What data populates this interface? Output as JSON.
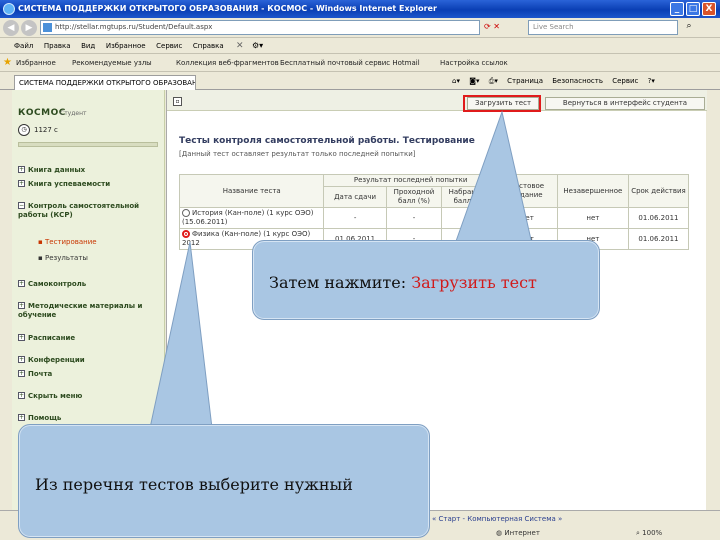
{
  "window": {
    "title": "СИСТЕМА ПОДДЕРЖКИ ОТКРЫТОГО ОБРАЗОВАНИЯ - КОСМОС - Windows Internet Explorer",
    "minimize": "_",
    "maximize": "□",
    "close": "X"
  },
  "browser": {
    "address": "http://stellar.mgtups.ru/Student/Default.aspx",
    "search_placeholder": "Live Search",
    "menu": [
      "Файл",
      "Правка",
      "Вид",
      "Избранное",
      "Сервис",
      "Справка"
    ],
    "favorites_label": "Избранное",
    "favorites": [
      "Рекомендуемые узлы",
      "Коллекция веб-фрагментов",
      "Бесплатный почтовый сервис Hotmail",
      "Настройка ссылок"
    ],
    "tab_label": "СИСТЕМА ПОДДЕРЖКИ ОТКРЫТОГО ОБРАЗОВАНИЯ - КОСМОС",
    "toolbar_items": [
      "Страница",
      "Безопасность",
      "Сервис"
    ]
  },
  "sidebar": {
    "logo": "КОСМОС",
    "logo_sub": "Студент",
    "counter": "1127 с",
    "items": [
      {
        "label": "Книга данных"
      },
      {
        "label": "Книга успеваемости"
      },
      {
        "label": "Контроль самостоятельной работы (КСР)"
      },
      {
        "label": "Самоконтроль"
      },
      {
        "label": "Методические материалы и обучение"
      },
      {
        "label": "Расписание"
      },
      {
        "label": "Конференции"
      },
      {
        "label": "Почта"
      },
      {
        "label": "Скрыть меню"
      },
      {
        "label": "Помощь"
      }
    ],
    "subitems": [
      {
        "label": "Тестирование",
        "active": true
      },
      {
        "label": "Результаты",
        "active": false
      }
    ]
  },
  "main": {
    "load_test_button": "Загрузить тест",
    "back_button": "Вернуться в интерфейс студента",
    "title": "Тесты контроля самостоятельной работы. Тестирование",
    "subtitle": "[Данный тест оставляет результат только последней попытки]",
    "table": {
      "col_name": "Название теста",
      "group_header": "Результат последней попытки",
      "col_date": "Дата сдачи",
      "col_passing": "Проходной балл (%)",
      "col_scored": "Набранный балл (%)",
      "col_tested": "Тестовое задание",
      "col_unfinished": "Незавершенное",
      "col_deadline": "Срок действия",
      "rows": [
        {
          "name": "История (Кан-поле) (1 курс ОЭО) (15.06.2011)",
          "date": "-",
          "passing": "-",
          "scored": "-",
          "tested": "нет",
          "unfinished": "нет",
          "deadline": "01.06.2011",
          "selected": false
        },
        {
          "name": "Физика (Кан-поле) (1 курс ОЭО) 2012",
          "date": "01.06.2011",
          "passing": "-",
          "scored": "-",
          "tested": "нет",
          "unfinished": "нет",
          "deadline": "01.06.2011",
          "selected": true
        }
      ]
    }
  },
  "statusbar": {
    "link": "Старт - Компьютерная Система",
    "zone": "Интернет",
    "zoom": "100%"
  },
  "callouts": {
    "load_prefix": "Затем нажмите: ",
    "load_accent": "Загрузить тест",
    "choose": "Из перечня тестов выберите нужный"
  },
  "colors": {
    "highlight": "#e01b1b",
    "callout_fill": "#a9c6e3",
    "sidebar_bg": "#ecf1dc",
    "title_bar": "#0a3fb4"
  }
}
